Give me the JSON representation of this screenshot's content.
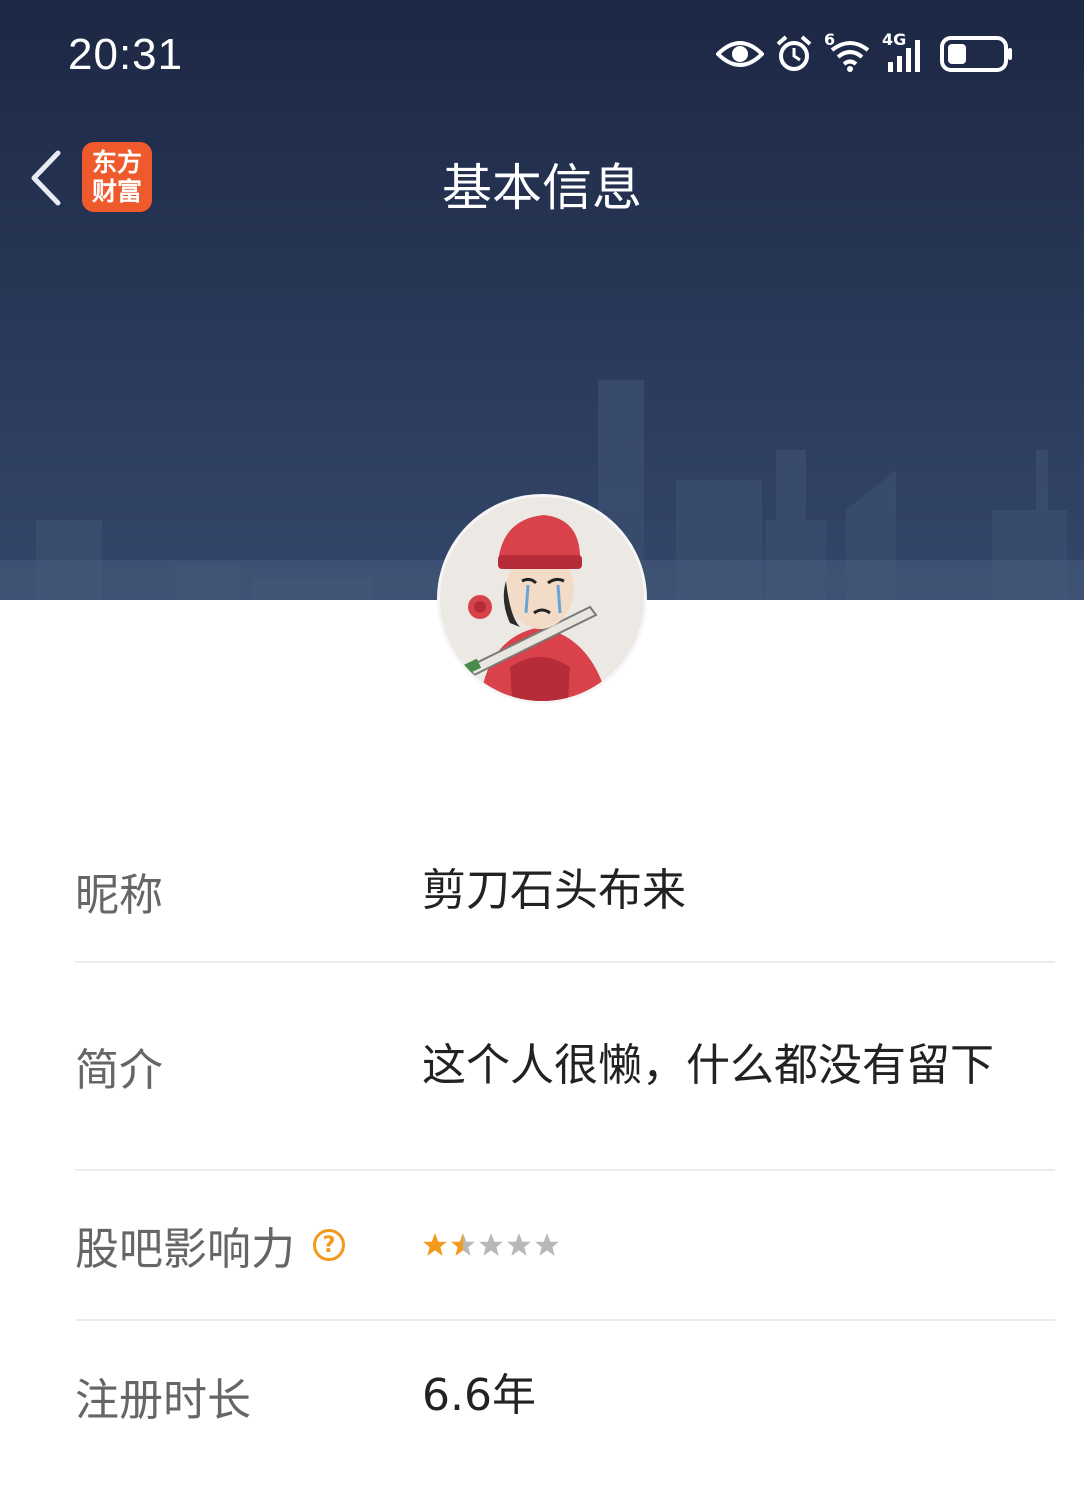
{
  "status_bar": {
    "time": "20:31",
    "icons": [
      "eye-icon",
      "alarm-icon",
      "wifi-icon",
      "signal-4g-icon",
      "battery-icon"
    ],
    "wifi_badge": "6",
    "network_badge": "4G"
  },
  "nav": {
    "back_icon": "chevron-left-icon",
    "logo_line1": "东方",
    "logo_line2": "财富",
    "title": "基本信息"
  },
  "profile": {
    "avatar_icon": "cartoon-avatar",
    "rows": [
      {
        "label": "昵称",
        "value": "剪刀石头布来"
      },
      {
        "label": "简介",
        "value": "这个人很懒，什么都没有留下"
      },
      {
        "label": "股吧影响力",
        "help": "?",
        "rating": 1.5,
        "rating_max": 5
      },
      {
        "label": "注册时长",
        "value": "6.6年"
      }
    ]
  },
  "colors": {
    "banner_top": "#1c2744",
    "banner_bottom": "#34476a",
    "logo_bg": "#ef5a2c",
    "accent": "#f39a1c",
    "star_empty": "#b8b8b8"
  }
}
